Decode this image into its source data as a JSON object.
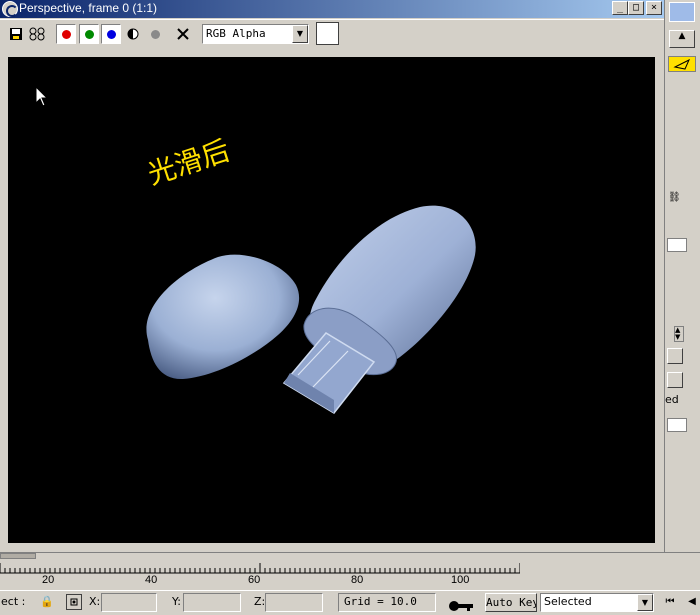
{
  "window": {
    "title": "Perspective, frame 0 (1:1)",
    "min_glyph": "_",
    "max_glyph": "□",
    "close_glyph": "×"
  },
  "toolbar": {
    "channel_value": "RGB Alpha",
    "colors": {
      "red": "#e00000",
      "green": "#008a00",
      "blue": "#0000e0"
    }
  },
  "viewport": {
    "annotation": "光滑后",
    "background": "#000000",
    "model_color": "#a9bbdb"
  },
  "right_panel": {
    "fragment_ed": "ed"
  },
  "timeline": {
    "ticks": [
      "20",
      "40",
      "60",
      "80",
      "100"
    ]
  },
  "status": {
    "left_fragment": "ect :",
    "x_label": "X:",
    "y_label": "Y:",
    "z_label": "Z:",
    "grid": "Grid = 10.0",
    "auto_key": "Auto Key",
    "selected": "Selected"
  }
}
